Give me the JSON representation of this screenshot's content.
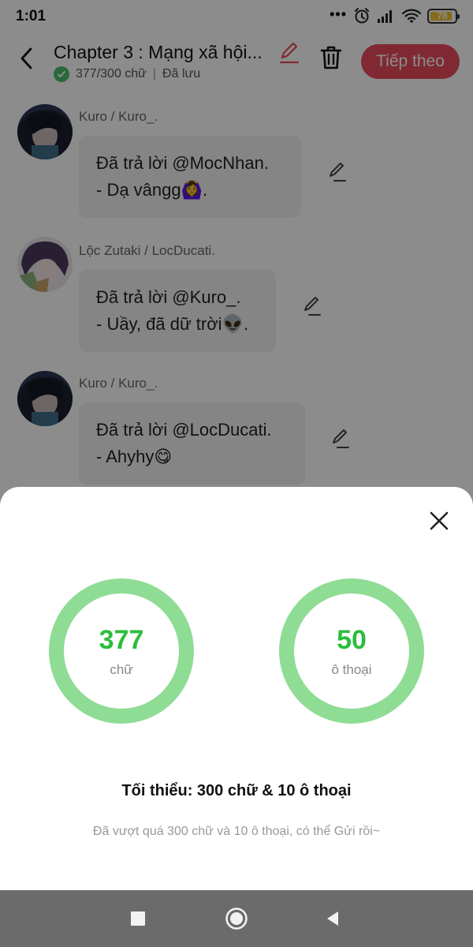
{
  "status_bar": {
    "time": "1:01",
    "battery": "78",
    "icons": [
      "more-dots-icon",
      "alarm-icon",
      "signal-icon",
      "wifi-icon",
      "battery-icon"
    ]
  },
  "header": {
    "title": "Chapter 3 : Mạng xã hội...",
    "word_count": "377/300 chữ",
    "saved": "Đã lưu",
    "next_label": "Tiếp theo"
  },
  "messages": [
    {
      "author": "Kuro / Kuro_.",
      "line1": "Đã trả lời @MocNhan.",
      "line2": "- Dạ vângg🙆‍♀️."
    },
    {
      "author": "Lộc Zutaki / LocDucati.",
      "line1": "Đã trả lời @Kuro_.",
      "line2": "- Uầy, đã dữ trời👽."
    },
    {
      "author": "Kuro / Kuro_.",
      "line1": "Đã trả lời @LocDucati.",
      "line2": "- Ahyhy😋"
    }
  ],
  "sheet": {
    "words_value": "377",
    "words_label": "chữ",
    "dialog_value": "50",
    "dialog_label": "ô thoại",
    "minimum": "Tối thiểu: 300 chữ & 10 ô thoại",
    "note": "Đã vượt quá 300 chữ và 10 ô thoại, có thể Gửi rồi~"
  },
  "colors": {
    "accent": "#e94b5b",
    "ring": "#8fdc95",
    "ring_value": "#2bbd3c",
    "check": "#4cc06a"
  }
}
